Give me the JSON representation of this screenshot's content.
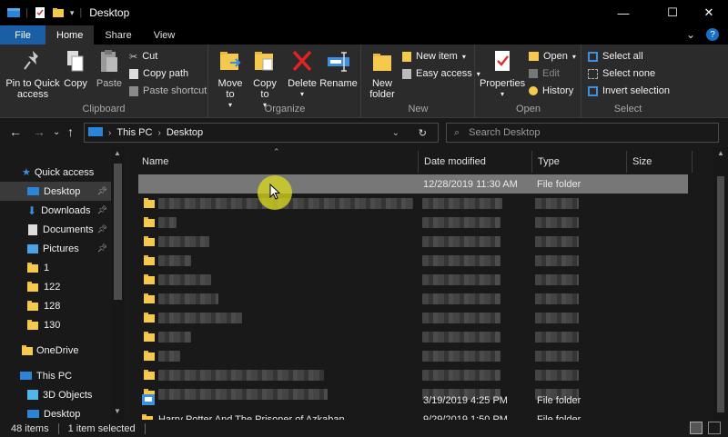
{
  "window": {
    "title": "Desktop"
  },
  "tabs": [
    {
      "label": "File"
    },
    {
      "label": "Home"
    },
    {
      "label": "Share"
    },
    {
      "label": "View"
    }
  ],
  "ribbon": {
    "clipboard": {
      "label": "Clipboard",
      "pin_label": "Pin to Quick access",
      "copy_label": "Copy",
      "paste_label": "Paste",
      "cut_label": "Cut",
      "copy_path_label": "Copy path",
      "paste_shortcut_label": "Paste shortcut"
    },
    "organize": {
      "label": "Organize",
      "move_to_label": "Move to",
      "copy_to_label": "Copy to",
      "delete_label": "Delete",
      "rename_label": "Rename"
    },
    "new": {
      "label": "New",
      "new_folder_label": "New folder",
      "new_item_label": "New item",
      "easy_access_label": "Easy access"
    },
    "open": {
      "label": "Open",
      "properties_label": "Properties",
      "open_label": "Open",
      "edit_label": "Edit",
      "history_label": "History"
    },
    "select": {
      "label": "Select",
      "select_all_label": "Select all",
      "select_none_label": "Select none",
      "invert_label": "Invert selection"
    }
  },
  "address": {
    "crumbs": [
      "This PC",
      "Desktop"
    ],
    "search_placeholder": "Search Desktop"
  },
  "navpane": {
    "items": [
      {
        "label": "Quick access"
      },
      {
        "label": "Desktop"
      },
      {
        "label": "Downloads"
      },
      {
        "label": "Documents"
      },
      {
        "label": "Pictures"
      },
      {
        "label": "1"
      },
      {
        "label": "122"
      },
      {
        "label": "128"
      },
      {
        "label": "130"
      },
      {
        "label": "OneDrive"
      },
      {
        "label": "This PC"
      },
      {
        "label": "3D Objects"
      },
      {
        "label": "Desktop"
      }
    ]
  },
  "columns": {
    "name": "Name",
    "date": "Date modified",
    "type": "Type",
    "size": "Size"
  },
  "files": {
    "selected": {
      "date": "12/28/2019 11:30 AM",
      "type": "File folder"
    },
    "row_a": {
      "date": "3/19/2019 4:25 PM",
      "type": "File folder"
    },
    "row_b": {
      "name": "Harry Potter And The Prisoner of Azkaban",
      "date": "9/29/2019 1:50 PM",
      "type": "File folder"
    }
  },
  "status": {
    "items": "48 items",
    "selected": "1 item selected"
  },
  "colors": {
    "file_tab": "#1a5fa6",
    "folder": "#f5c94d",
    "cursor_highlight": "#dcdc1e"
  }
}
